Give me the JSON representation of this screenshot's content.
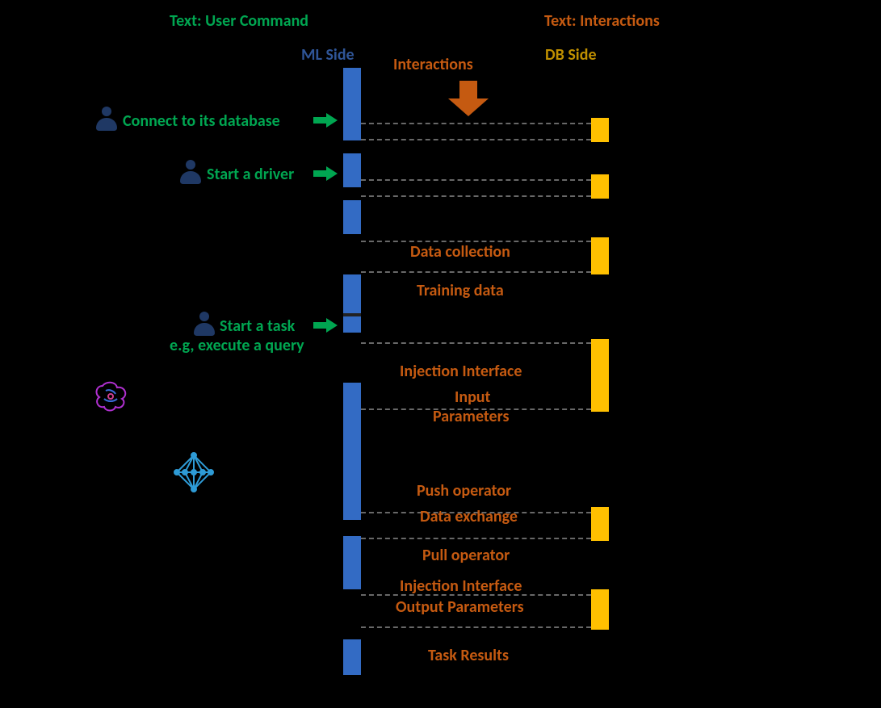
{
  "headers": {
    "user_command": "Text: User Command",
    "interactions_header": "Text:  Interactions",
    "ml_side": "ML Side",
    "db_side": "DB Side",
    "interactions_label": "Interactions"
  },
  "commands": {
    "connect_db": "Connect to its database",
    "start_driver": "Start a driver",
    "start_task": "Start a task",
    "start_task_sub": "e.g, execute a query"
  },
  "interactions": {
    "data_collection": "Data collection",
    "training_data": "Training data",
    "injection_interface": "Injection Interface",
    "input_parameters_l1": "Input",
    "input_parameters_l2": "Parameters",
    "push_operator": "Push operator",
    "data_exchange": "Data exchange",
    "pull_operator": "Pull operator",
    "injection_interface2": "Injection Interface",
    "output_parameters": "Output Parameters",
    "task_results": "Task Results"
  },
  "colors": {
    "green": "#00A651",
    "orange": "#C55A11",
    "blue": "#2F5597",
    "yellow_text": "#BF8F00",
    "ml_bar": "#336BC4",
    "db_bar": "#FFC000",
    "person": "#1F3864",
    "background": "#000000"
  }
}
